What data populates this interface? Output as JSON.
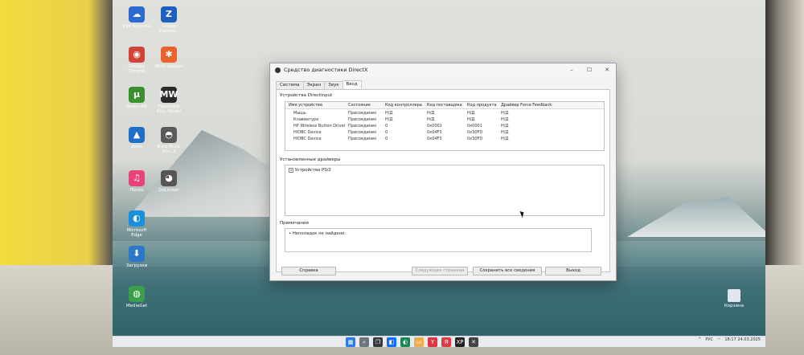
{
  "desktop": {
    "icons": [
      {
        "label": "Eye hysteria",
        "glyph": "☁",
        "color": "#2b6ad1"
      },
      {
        "label": "Goose\nExplore..",
        "glyph": "Z",
        "color": "#1f5fbf"
      },
      {
        "label": "Google\nChrome",
        "glyph": "◉",
        "color": "#d04437"
      },
      {
        "label": "Wish dokkan",
        "glyph": "✱",
        "color": "#e8632c"
      },
      {
        "label": "Уклон-ВЕ",
        "glyph": "μ",
        "color": "#3c8f2f"
      },
      {
        "label": "Flashlight\nEnv. Model",
        "glyph": "MW",
        "color": "#2a2a2a"
      },
      {
        "label": "Zona",
        "glyph": "▲",
        "color": "#1f6fc6"
      },
      {
        "label": "Euro Truck\nSim. 2",
        "glyph": "◓",
        "color": "#5a5a5a"
      },
      {
        "label": "iTunes",
        "glyph": "♫",
        "color": "#e8447a"
      },
      {
        "label": "DeLocker",
        "glyph": "◕",
        "color": "#555"
      },
      {
        "label": "Microsoft\nEdge",
        "glyph": "◐",
        "color": "#1b8fd9"
      },
      {
        "label": "Загрузки",
        "glyph": "⬇",
        "color": "#2a79c9"
      },
      {
        "label": "MediaGet",
        "glyph": "◍",
        "color": "#3a9f4a"
      }
    ],
    "recycle_label": "Корзина"
  },
  "dialog": {
    "title": "Средство диагностики DirectX",
    "tabs": [
      "Система",
      "Экран",
      "Звук",
      "Ввод"
    ],
    "active_tab": "Ввод",
    "devices_group_title": "Устройства DirectInput",
    "columns": [
      "Имя устройства",
      "Состояние",
      "Код контроллера",
      "Код поставщика",
      "Код продукта",
      "Драйвер Force Feedback"
    ],
    "rows": [
      [
        "Мышь",
        "Присоединен",
        "Н/Д",
        "Н/Д",
        "Н/Д",
        "Н/Д"
      ],
      [
        "Клавиатура",
        "Присоединен",
        "Н/Д",
        "Н/Д",
        "Н/Д",
        "Н/Д"
      ],
      [
        "HP Wireless Button Driver",
        "Присоединен",
        "0",
        "0x0001",
        "0x0001",
        "Н/Д"
      ],
      [
        "HIDBC Device",
        "Присоединен",
        "0",
        "0x04F3",
        "0x30FD",
        "Н/Д"
      ],
      [
        "HIDBC Device",
        "Присоединен",
        "0",
        "0x04F3",
        "0x30FD",
        "Н/Д"
      ]
    ],
    "drivers_group_title": "Установленные драйверы",
    "drivers_tree_item": "Устройства PS/2",
    "notes_group_title": "Примечания",
    "notes_text": "Неполадок не найдено.",
    "buttons": {
      "help": "Справка",
      "next": "Следующая страница",
      "save_all": "Сохранить все сведения",
      "exit": "Выход"
    }
  },
  "taskbar": {
    "lang": "РУС",
    "time": "18:17",
    "date": "24.03.2025"
  }
}
